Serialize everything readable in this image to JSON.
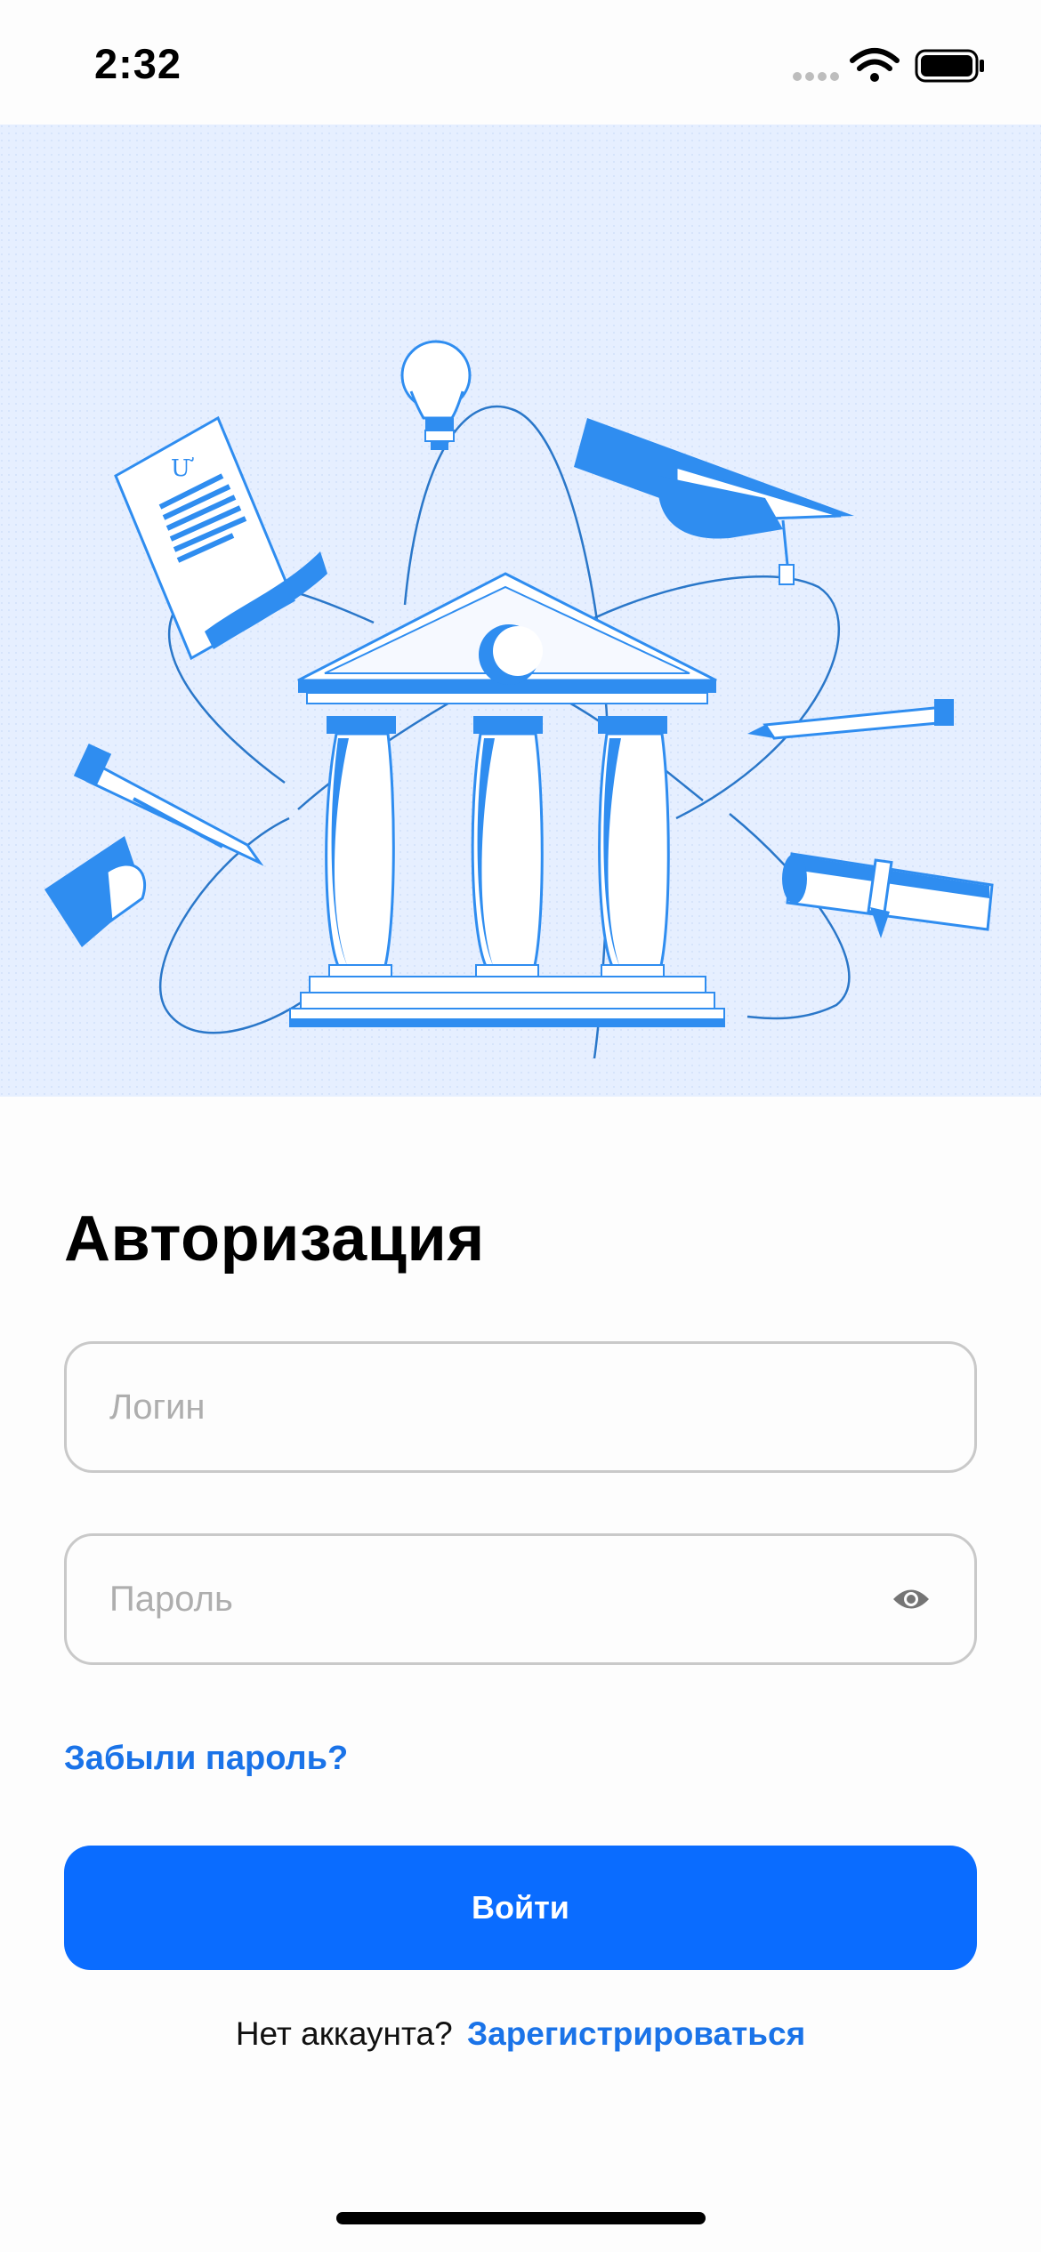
{
  "status_bar": {
    "time": "2:32",
    "icons": [
      "signal-dots-icon",
      "wifi-icon",
      "battery-icon"
    ]
  },
  "hero": {
    "illustration": "university-building-illustration",
    "accent_color": "#2f8df0",
    "background_color": "#e6efff"
  },
  "auth": {
    "title": "Авторизация",
    "login_placeholder": "Логин",
    "login_value": "",
    "password_placeholder": "Пароль",
    "password_value": "",
    "password_toggle_icon": "eye-icon",
    "forgot_password": "Забыли пароль?",
    "submit": "Войти",
    "no_account": "Нет аккаунта?",
    "register": "Зарегистрироваться"
  },
  "colors": {
    "primary": "#0a6cff",
    "link": "#1a73e8",
    "border": "#c9c9c9",
    "placeholder": "#aeaeae"
  }
}
